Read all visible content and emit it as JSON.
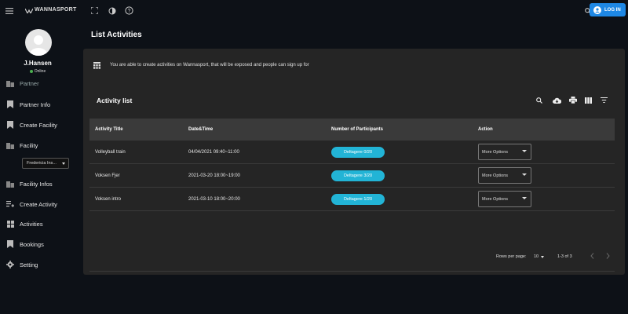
{
  "topbar": {
    "brand": "WANNASPORT",
    "login_label": "LOG IN",
    "icons": [
      "menu-icon",
      "fullscreen-icon",
      "contrast-icon",
      "help-icon",
      "search-icon",
      "user-circle-icon"
    ]
  },
  "sidebar": {
    "username": "J.Hansen",
    "status": "Online",
    "partner_header": "Partner",
    "items": [
      {
        "label": "Partner Info",
        "icon": "bookmark-icon"
      },
      {
        "label": "Create Facility",
        "icon": "bookmark-icon"
      },
      {
        "label": "Facility",
        "icon": "building-icon"
      }
    ],
    "facility_select": "Fredericia Ins...",
    "items2": [
      {
        "label": "Facility Infos",
        "icon": "building-icon"
      },
      {
        "label": "Create Activity",
        "icon": "add-list-icon"
      },
      {
        "label": "Activities",
        "icon": "grid-icon"
      },
      {
        "label": "Bookings",
        "icon": "bookmark-icon"
      },
      {
        "label": "Setting",
        "icon": "gear-icon"
      }
    ]
  },
  "main": {
    "page_title": "List Activities",
    "info_text": "You are able to create activities on Wannasport, that will be exposed and people can sign up for",
    "card_title": "Activity list",
    "columns": [
      "Activity Title",
      "Date&Time",
      "Number of Participants",
      "Action"
    ],
    "rows": [
      {
        "title": "Volleyball train",
        "datetime": "04/04/2021 09:40~11:00",
        "participants": "Deltagere 0/20",
        "action": "More Options"
      },
      {
        "title": "Voksen Fjer",
        "datetime": "2021-03-20 18:00~19:00",
        "participants": "Deltagere 3/20",
        "action": "More Options"
      },
      {
        "title": "Voksen intro",
        "datetime": "2021-03-10 18:00~20:00",
        "participants": "Deltagere 1/20",
        "action": "More Options"
      }
    ],
    "pagination": {
      "rows_per_page_label": "Rows per page:",
      "rows_per_page": "10",
      "range": "1-3 of 3"
    }
  },
  "colors": {
    "background": "#0d1117",
    "card": "#252525",
    "accent": "#22b4d6",
    "login": "#1e88e5",
    "online": "#4caf50"
  }
}
